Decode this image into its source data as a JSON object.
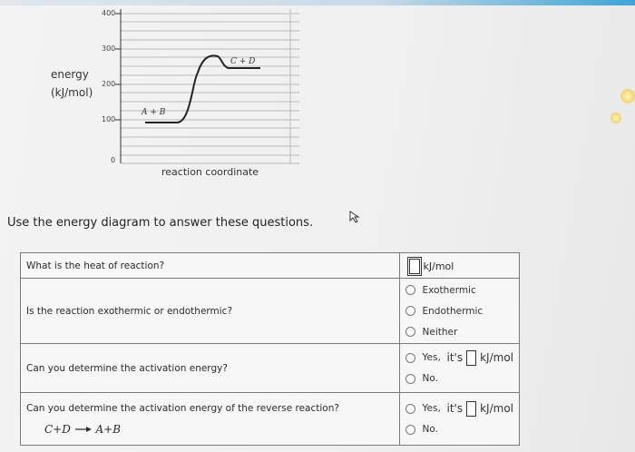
{
  "diagram": {
    "y_label_line1": "energy",
    "y_label_line2": "(kJ/mol)",
    "ticks": [
      "400",
      "300",
      "200",
      "100",
      "0"
    ],
    "x_label": "reaction coordinate",
    "reactants": "A + B",
    "products": "C + D"
  },
  "instruction": "Use the energy diagram to answer these questions.",
  "questions": {
    "q1": "What is the heat of reaction?",
    "q1_unit": "kJ/mol",
    "q2": "Is the reaction exothermic or endothermic?",
    "q2_opt1": "Exothermic",
    "q2_opt2": "Endothermic",
    "q2_opt3": "Neither",
    "q3": "Can you determine the activation energy?",
    "q3_yes_prefix": "Yes,",
    "q3_yes_its": "it's",
    "q3_unit": "kJ/mol",
    "q3_no": "No.",
    "q4": "Can you determine the activation energy of the reverse reaction?",
    "q4_eq_left": "C+D",
    "q4_eq_right": "A+B",
    "q4_yes_prefix": "Yes,",
    "q4_yes_its": "it's",
    "q4_unit": "kJ/mol",
    "q4_no": "No."
  }
}
